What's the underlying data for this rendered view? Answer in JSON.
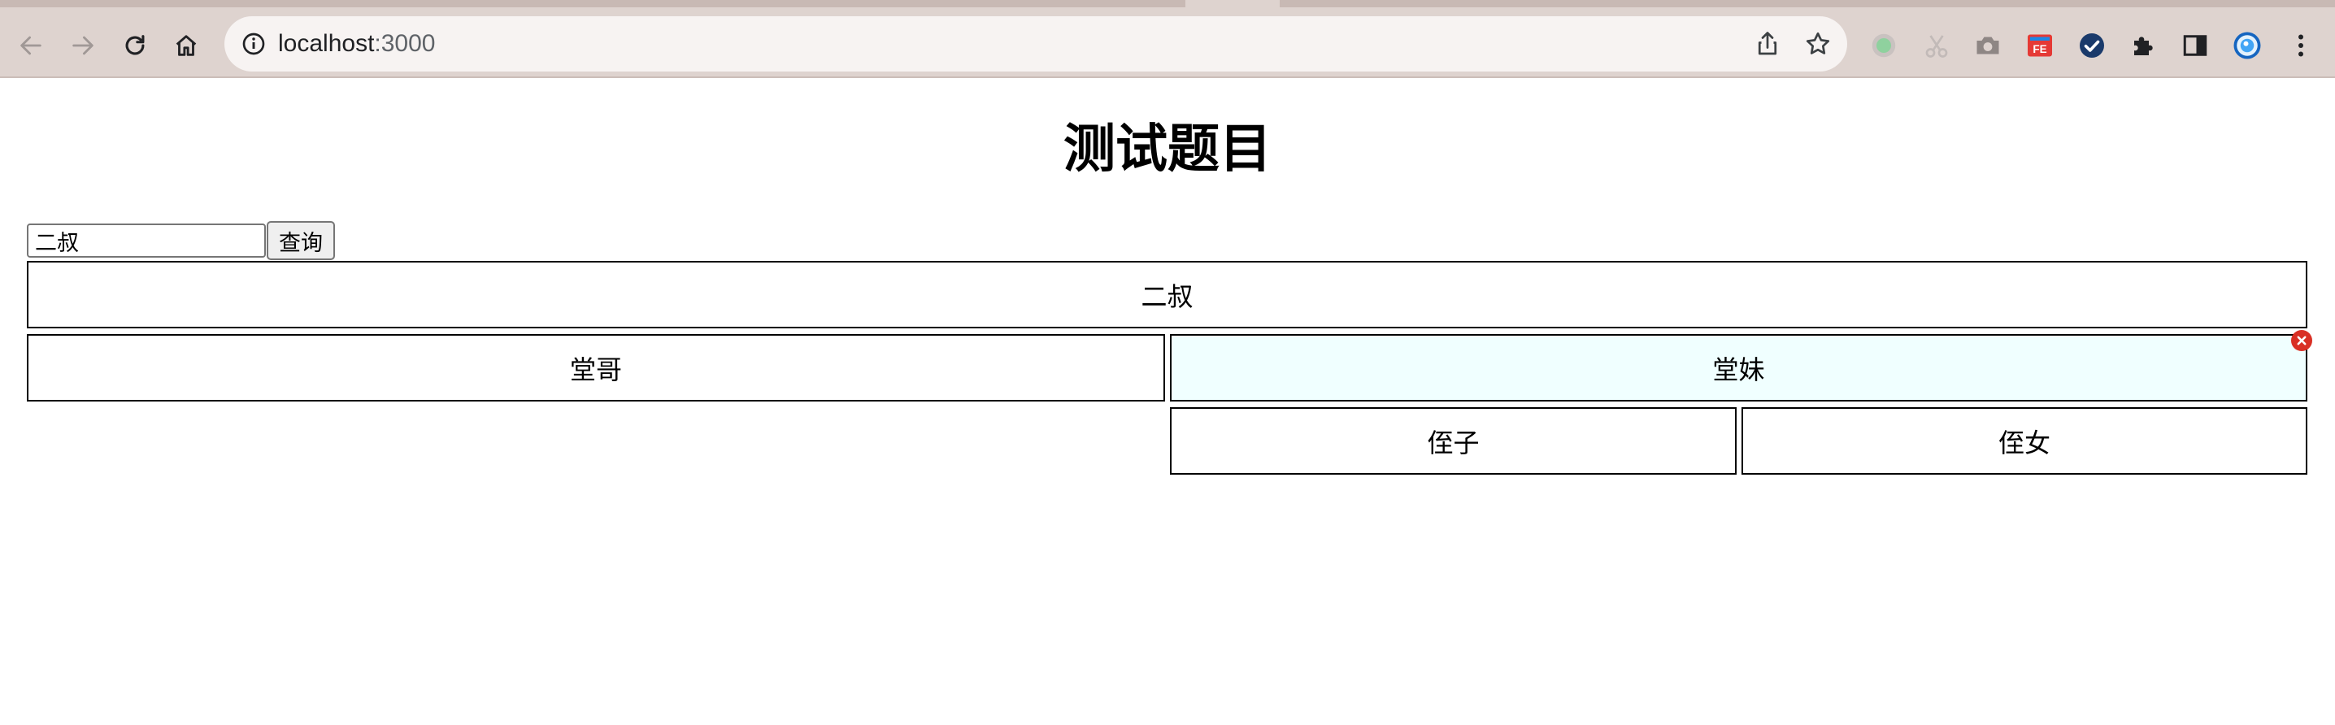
{
  "browser": {
    "url_host": "localhost",
    "url_port": ":3000",
    "nav_icons": [
      "back-arrow-icon",
      "forward-arrow-icon",
      "reload-icon",
      "home-icon"
    ],
    "omnibox_icons": [
      "info-icon",
      "share-icon",
      "bookmark-star-icon"
    ],
    "extension_icons": [
      "green-circle-extension-icon",
      "scissors-extension-icon",
      "camera-extension-icon",
      "fe-extension-icon",
      "check-extension-icon",
      "puzzle-extensions-icon",
      "side-panel-icon",
      "profile-avatar-icon",
      "kebab-menu-icon"
    ],
    "fe_badge_text": "FE"
  },
  "page": {
    "title": "测试题目",
    "search": {
      "value": "二叔"
    },
    "query_button": "查询",
    "tree": {
      "root": "二叔",
      "children": [
        "堂哥",
        "堂妹"
      ],
      "grandchildren": [
        "侄子",
        "侄女"
      ]
    },
    "highlight_color": "#f0ffff",
    "close_badge_icon": "close-x-icon"
  }
}
